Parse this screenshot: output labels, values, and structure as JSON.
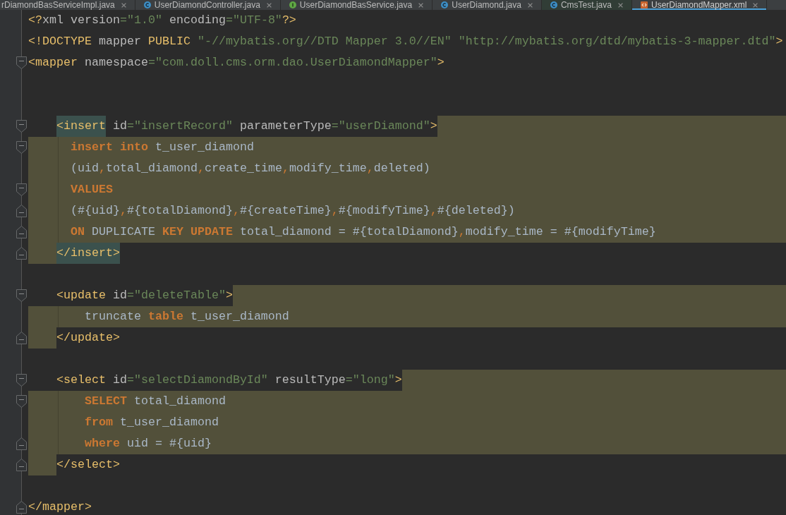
{
  "tabs": [
    {
      "label": "rDiamondBasServiceImpl.java",
      "selected": false,
      "color": "#3c3f41"
    },
    {
      "label": "UserDiamondController.java",
      "kind": "class",
      "selected": false,
      "color": "#3c3f41"
    },
    {
      "label": "UserDiamondBasService.java",
      "kind": "interface",
      "selected": false,
      "color": "#3c3f41"
    },
    {
      "label": "UserDiamond.java",
      "kind": "class",
      "selected": false,
      "color": "#3c3f41"
    },
    {
      "label": "CmsTest.java",
      "kind": "class",
      "selected": false,
      "color": "#313d36"
    },
    {
      "label": "UserDiamondMapper.xml",
      "kind": "xml",
      "selected": true,
      "color": "#3c3f41"
    }
  ],
  "editor": {
    "lines": [
      {
        "kind": "plain",
        "tokens": [
          {
            "kind": "tag",
            "text": "<?",
            "matched": false
          },
          {
            "kind": "attr",
            "text": "xml version"
          },
          {
            "kind": "value",
            "text": "=\"1.0\""
          },
          {
            "kind": "attr",
            "text": " encoding"
          },
          {
            "kind": "value",
            "text": "=\"UTF-8\""
          },
          {
            "kind": "tag",
            "text": "?>",
            "matched": false
          }
        ]
      },
      {
        "kind": "plain",
        "tokens": [
          {
            "kind": "tag",
            "text": "<!DOCTYPE",
            "matched": false
          },
          {
            "kind": "attr",
            "text": " mapper "
          },
          {
            "kind": "tag",
            "text": "PUBLIC",
            "matched": false
          },
          {
            "kind": "value",
            "text": " \"-//mybatis.org//DTD Mapper 3.0//EN\" \"http://mybatis.org/dtd/mybatis-3-mapper.dtd\""
          },
          {
            "kind": "tag",
            "text": ">",
            "matched": false
          }
        ]
      },
      {
        "kind": "plain",
        "fold": {
          "kind": "start"
        },
        "tokens": [
          {
            "kind": "tag",
            "text": "<mapper",
            "matched": false
          },
          {
            "kind": "attr",
            "text": " namespace"
          },
          {
            "kind": "value",
            "text": "=\"com.doll.cms.orm.dao.UserDiamondMapper\""
          },
          {
            "kind": "tag",
            "text": ">",
            "matched": false
          }
        ]
      },
      {
        "kind": "blank"
      },
      {
        "kind": "blank"
      },
      {
        "kind": "opener",
        "fold": {
          "kind": "start"
        },
        "tokens": [
          {
            "kind": "tag",
            "text": "    <insert",
            "matched": true
          },
          {
            "kind": "attr",
            "text": " id"
          },
          {
            "kind": "value",
            "text": "=\"insertRecord\""
          },
          {
            "kind": "attr",
            "text": " parameterType"
          },
          {
            "kind": "value",
            "text": "=\"userDiamond\""
          },
          {
            "kind": "tag",
            "text": ">",
            "matched": false
          }
        ]
      },
      {
        "kind": "fragment",
        "fold": {
          "kind": "start"
        },
        "tokens": [
          {
            "kind": "keyword",
            "text": "      insert"
          },
          {
            "kind": "keyword",
            "text": " into"
          },
          {
            "kind": "text",
            "text": " t_user_diamond"
          }
        ]
      },
      {
        "kind": "fragment",
        "tokens": [
          {
            "kind": "text",
            "text": "      (uid"
          },
          {
            "kind": "symbol",
            "text": ","
          },
          {
            "kind": "text",
            "text": "total_diamond"
          },
          {
            "kind": "symbol",
            "text": ","
          },
          {
            "kind": "text",
            "text": "create_time"
          },
          {
            "kind": "symbol",
            "text": ","
          },
          {
            "kind": "text",
            "text": "modify_time"
          },
          {
            "kind": "symbol",
            "text": ","
          },
          {
            "kind": "text",
            "text": "deleted)"
          }
        ]
      },
      {
        "kind": "fragment",
        "fold": {
          "kind": "start"
        },
        "tokens": [
          {
            "kind": "keyword",
            "text": "      VALUES"
          }
        ]
      },
      {
        "kind": "fragment",
        "fold": {
          "kind": "end"
        },
        "tokens": [
          {
            "kind": "text",
            "text": "      (#{uid}"
          },
          {
            "kind": "symbol",
            "text": ","
          },
          {
            "kind": "text",
            "text": "#{totalDiamond}"
          },
          {
            "kind": "symbol",
            "text": ","
          },
          {
            "kind": "text",
            "text": "#{createTime}"
          },
          {
            "kind": "symbol",
            "text": ","
          },
          {
            "kind": "text",
            "text": "#{modifyTime}"
          },
          {
            "kind": "symbol",
            "text": ","
          },
          {
            "kind": "text",
            "text": "#{deleted})"
          }
        ]
      },
      {
        "kind": "fragment",
        "fold": {
          "kind": "end"
        },
        "tokens": [
          {
            "kind": "keyword",
            "text": "      ON"
          },
          {
            "kind": "text",
            "text": " DUPLICATE"
          },
          {
            "kind": "keyword",
            "text": " KEY"
          },
          {
            "kind": "keyword",
            "text": " UPDATE"
          },
          {
            "kind": "text",
            "text": " total_diamond = #{totalDiamond}"
          },
          {
            "kind": "symbol",
            "text": ","
          },
          {
            "kind": "text",
            "text": "modify_time = #{modifyTime}"
          }
        ]
      },
      {
        "kind": "closer",
        "fold": {
          "kind": "end"
        },
        "tokens": [
          {
            "kind": "tag",
            "text": "    </insert>",
            "matched": true
          }
        ]
      },
      {
        "kind": "blank"
      },
      {
        "kind": "opener",
        "fold": {
          "kind": "start"
        },
        "tokens": [
          {
            "kind": "tag",
            "text": "    <update",
            "matched": false
          },
          {
            "kind": "attr",
            "text": " id"
          },
          {
            "kind": "value",
            "text": "=\"deleteTable\""
          },
          {
            "kind": "tag",
            "text": ">",
            "matched": false
          }
        ]
      },
      {
        "kind": "fragment",
        "tokens": [
          {
            "kind": "text",
            "text": "        truncate"
          },
          {
            "kind": "keyword",
            "text": " table"
          },
          {
            "kind": "text",
            "text": " t_user_diamond"
          }
        ]
      },
      {
        "kind": "closer",
        "fold": {
          "kind": "end"
        },
        "tokens": [
          {
            "kind": "tag",
            "text": "    </update>",
            "matched": false
          }
        ]
      },
      {
        "kind": "blank"
      },
      {
        "kind": "opener",
        "fold": {
          "kind": "start"
        },
        "tokens": [
          {
            "kind": "tag",
            "text": "    <select",
            "matched": false
          },
          {
            "kind": "attr",
            "text": " id"
          },
          {
            "kind": "value",
            "text": "=\"selectDiamondById\""
          },
          {
            "kind": "attr",
            "text": " resultType"
          },
          {
            "kind": "value",
            "text": "=\"long\""
          },
          {
            "kind": "tag",
            "text": ">",
            "matched": false
          }
        ]
      },
      {
        "kind": "fragment",
        "fold": {
          "kind": "start"
        },
        "tokens": [
          {
            "kind": "keyword",
            "text": "        SELECT"
          },
          {
            "kind": "text",
            "text": " total_diamond"
          }
        ]
      },
      {
        "kind": "fragment",
        "tokens": [
          {
            "kind": "keyword",
            "text": "        from"
          },
          {
            "kind": "text",
            "text": " t_user_diamond"
          }
        ]
      },
      {
        "kind": "fragment",
        "fold": {
          "kind": "end"
        },
        "tokens": [
          {
            "kind": "keyword",
            "text": "        where"
          },
          {
            "kind": "text",
            "text": " uid = #{uid}"
          }
        ]
      },
      {
        "kind": "closer",
        "fold": {
          "kind": "end"
        },
        "tokens": [
          {
            "kind": "tag",
            "text": "    </select>",
            "matched": false
          }
        ]
      },
      {
        "kind": "blank"
      },
      {
        "kind": "plain",
        "fold": {
          "kind": "end"
        },
        "tokens": [
          {
            "kind": "tag",
            "text": "</mapper>",
            "matched": false
          }
        ]
      }
    ]
  }
}
